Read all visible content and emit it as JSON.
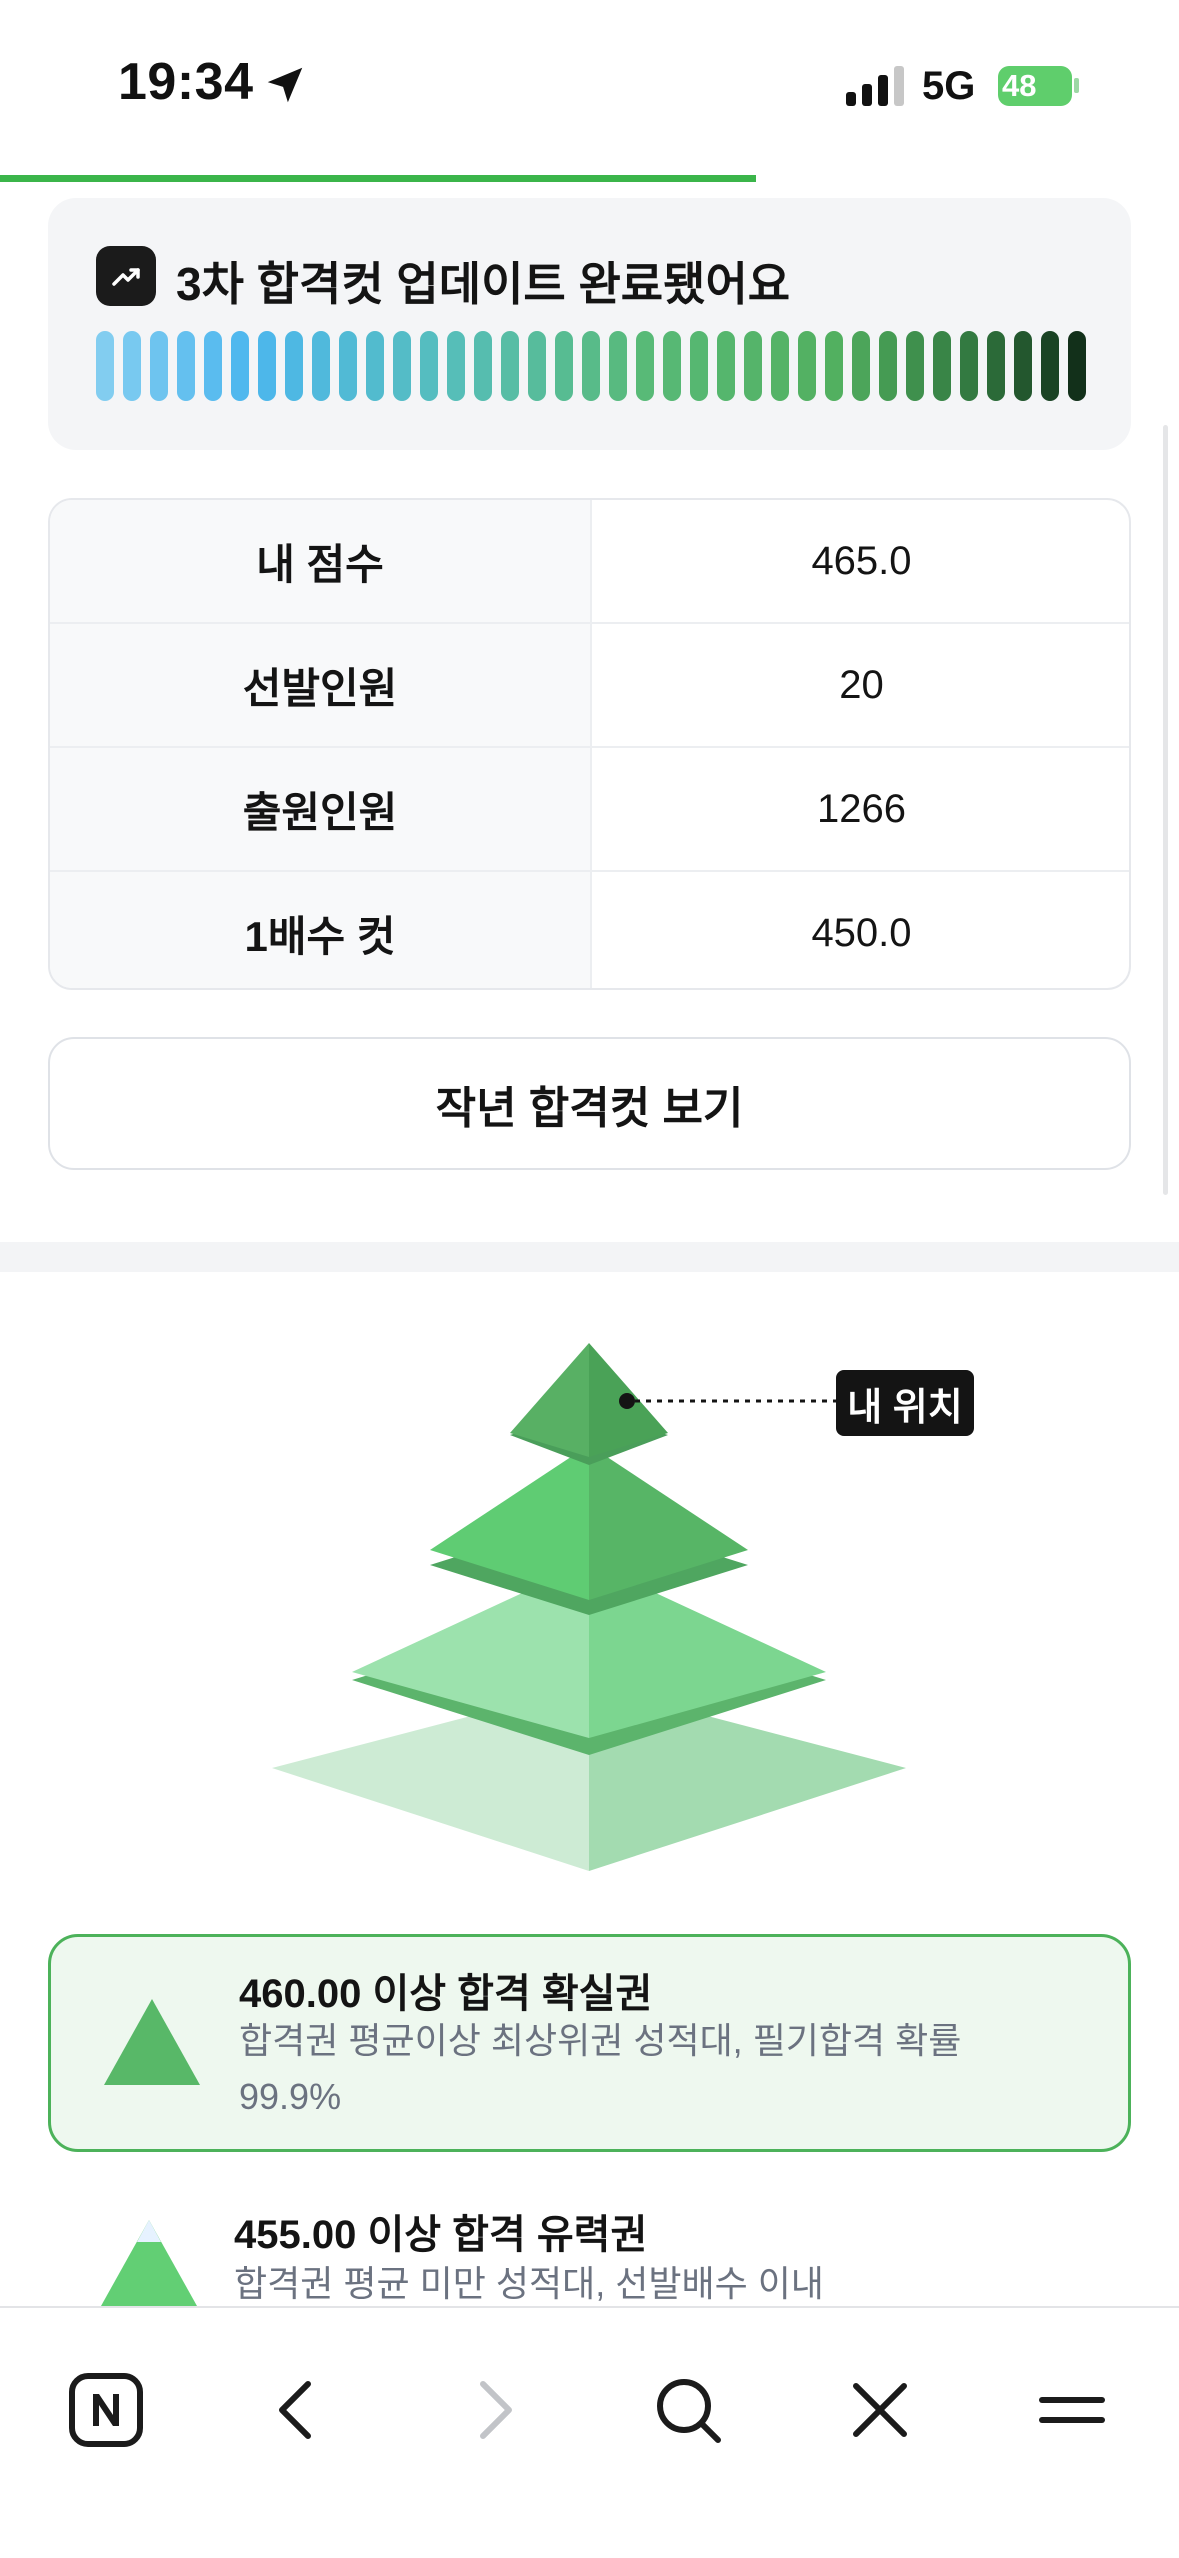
{
  "status_bar": {
    "time": "19:34",
    "network": "5G",
    "battery": "48"
  },
  "update_card": {
    "title": "3차 합격컷 업데이트 완료됐어요"
  },
  "info_table": {
    "rows": [
      {
        "label": "내 점수",
        "value": "465.0"
      },
      {
        "label": "선발인원",
        "value": "20"
      },
      {
        "label": "출원인원",
        "value": "1266"
      },
      {
        "label": "1배수 컷",
        "value": "450.0"
      }
    ]
  },
  "prev_year_button": "작년 합격컷 보기",
  "pyramid": {
    "my_position_label": "내 위치"
  },
  "levels": [
    {
      "title": "460.00 이상 합격 확실권",
      "desc": "합격권 평균이상 최상위권 성적대, 필기합격 확률 99.9%"
    },
    {
      "title": "455.00 이상 합격 유력권",
      "desc": "합격권 평균 미만 성적대, 선발배수 이내"
    }
  ],
  "toolbar_icons": [
    "naver-home-icon",
    "back-icon",
    "forward-icon",
    "search-icon",
    "close-icon",
    "menu-icon"
  ],
  "colors": {
    "accent": "#3bb54a",
    "level_border": "#4cb25a",
    "level_bg": "#eef8ef"
  }
}
